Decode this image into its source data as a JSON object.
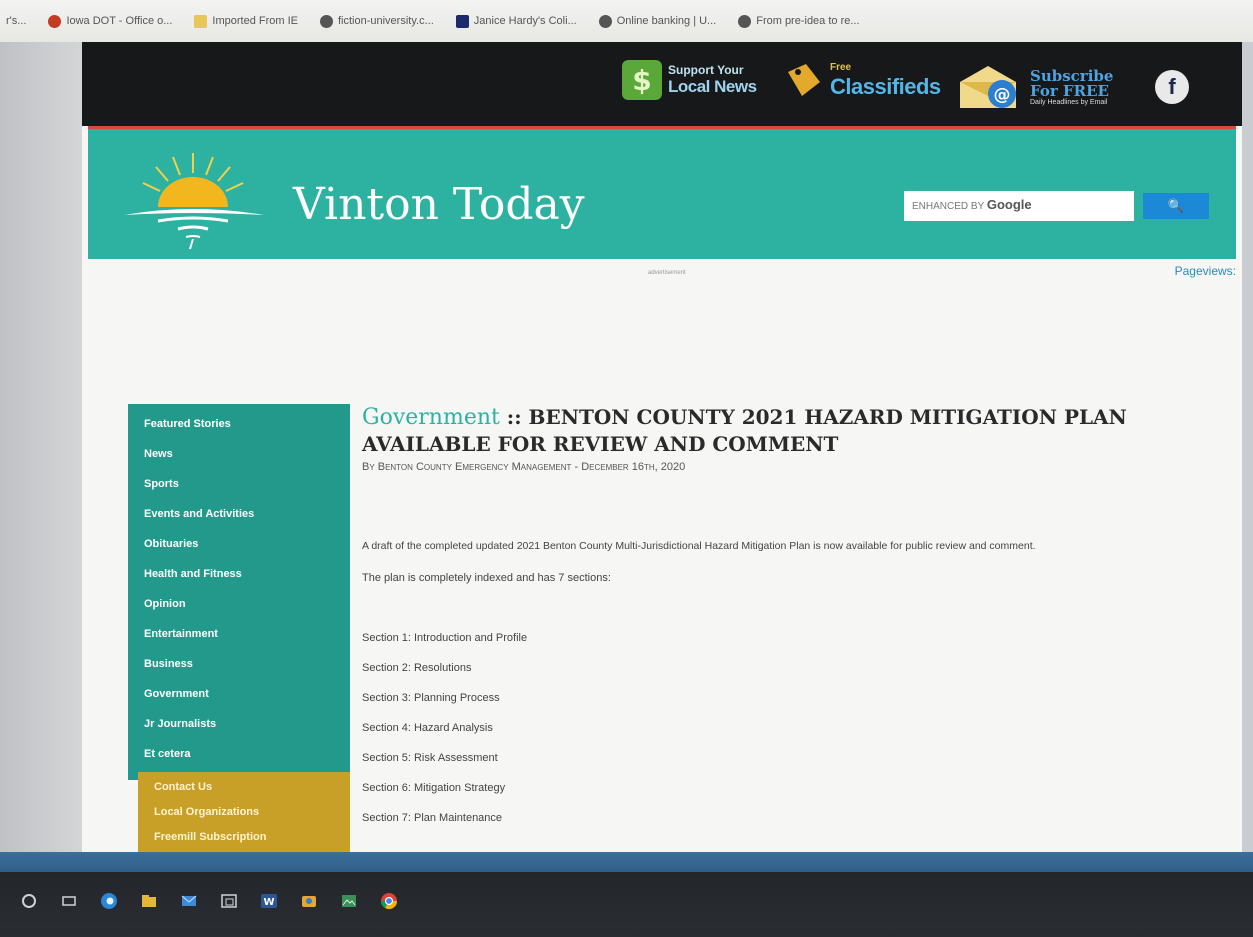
{
  "bookmarks": [
    {
      "label": "r's...",
      "icon": "none"
    },
    {
      "label": "Iowa DOT - Office o...",
      "icon": "red"
    },
    {
      "label": "Imported From IE",
      "icon": "folder"
    },
    {
      "label": "fiction-university.c...",
      "icon": "globe"
    },
    {
      "label": "Janice Hardy's Coli...",
      "icon": "blue"
    },
    {
      "label": "Online banking | U...",
      "icon": "globe"
    },
    {
      "label": "From pre-idea to re...",
      "icon": "globe"
    }
  ],
  "promos": {
    "local_news_small": "Support Your",
    "local_news_big": "Local News",
    "classifieds_small": "Free",
    "classifieds_big": "Classifieds",
    "subscribe_line1": "Subscribe",
    "subscribe_line2": "For FREE",
    "subscribe_line3": "Daily Headlines by Email",
    "facebook_letter": "f"
  },
  "header": {
    "site_title": "Vinton Today",
    "search_prefix": "ENHANCED BY",
    "search_brand": "Google",
    "search_button": "🔍",
    "pageviews": "Pageviews:"
  },
  "ad_label": "advertisement",
  "sidebar": {
    "items": [
      "Featured Stories",
      "News",
      "Sports",
      "Events and Activities",
      "Obituaries",
      "Health and Fitness",
      "Opinion",
      "Entertainment",
      "Business",
      "Government",
      "Jr Journalists",
      "Et cetera"
    ],
    "gold_items": [
      "Contact Us",
      "Local Organizations",
      "Freemill Subscription"
    ]
  },
  "article": {
    "category": "Government",
    "separator": " :: ",
    "title": "BENTON COUNTY 2021 HAZARD MITIGATION PLAN AVAILABLE FOR REVIEW AND COMMENT",
    "byline": "By Benton County Emergency Management - December 16th, 2020",
    "para1": "A draft of the completed updated 2021 Benton County Multi-Jurisdictional Hazard Mitigation Plan is now available for public review and comment.",
    "para2": "The plan is completely indexed and has 7 sections:",
    "sections": [
      "Section 1: Introduction and Profile",
      "Section 2: Resolutions",
      "Section 3: Planning Process",
      "Section 4: Hazard Analysis",
      "Section 5: Risk Assessment",
      "Section 6: Mitigation Strategy",
      "Section 7: Plan Maintenance"
    ]
  },
  "taskbar_icons": [
    "start-circle-icon",
    "task-view-icon",
    "edge-icon",
    "file-explorer-icon",
    "mail-icon",
    "window-icon",
    "word-icon",
    "folder-app-icon",
    "photos-icon",
    "chrome-icon"
  ]
}
